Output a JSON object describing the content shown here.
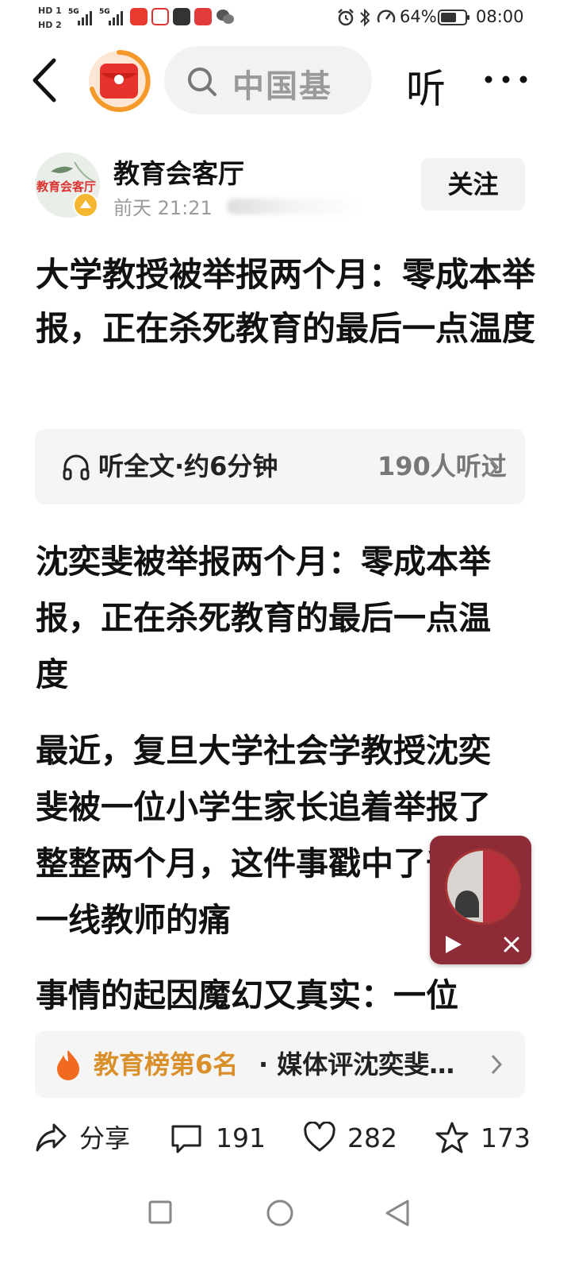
{
  "status_bar": {
    "sim1": "HD 1",
    "sim2": "HD 2",
    "net1": "5G",
    "net2": "5G",
    "battery": "64%",
    "time": "08:00",
    "app_icons": [
      "toutiao-app-icon",
      "bilibili-app-icon",
      "message-app-icon",
      "netease-app-icon",
      "wechat-app-icon"
    ],
    "status_icons": [
      "alarm-icon",
      "bluetooth-icon",
      "signal-meter-icon",
      "battery-icon"
    ]
  },
  "top_nav": {
    "search_text": "中国基",
    "listen_label": "听",
    "red_packet_colors": {
      "ring": "#f59a2a",
      "body": "#e8322d"
    }
  },
  "author": {
    "avatar_text": "教育会客厅",
    "name": "教育会客厅",
    "meta": "前天  21:21",
    "follow_label": "关注"
  },
  "article": {
    "title": "大学教授被举报两个月：零成本举报，正在杀死教育的最后一点温度",
    "listen_card": {
      "label": "听全文·约6分钟",
      "count": "190人听过"
    },
    "paragraphs": [
      "沈奕斐被举报两个月：零成本举报，正在杀死教育的最后一点温度",
      "最近，复旦大学社会学教授沈奕斐被一位小学生家长追着举报了整整两个月，这件事戳中了千万一线教师的痛",
      "事情的起因魔幻又真实：一位"
    ]
  },
  "float_player": {
    "accent": "#8d2b37"
  },
  "rank_bar": {
    "label": "教育榜第6名",
    "topic": "· 媒体评沈奕斐…"
  },
  "action_bar": {
    "share_label": "分享",
    "comments": "191",
    "likes": "282",
    "favorites": "173"
  },
  "nav_bar": {
    "buttons": [
      "recents-button",
      "home-button",
      "back-button"
    ]
  }
}
